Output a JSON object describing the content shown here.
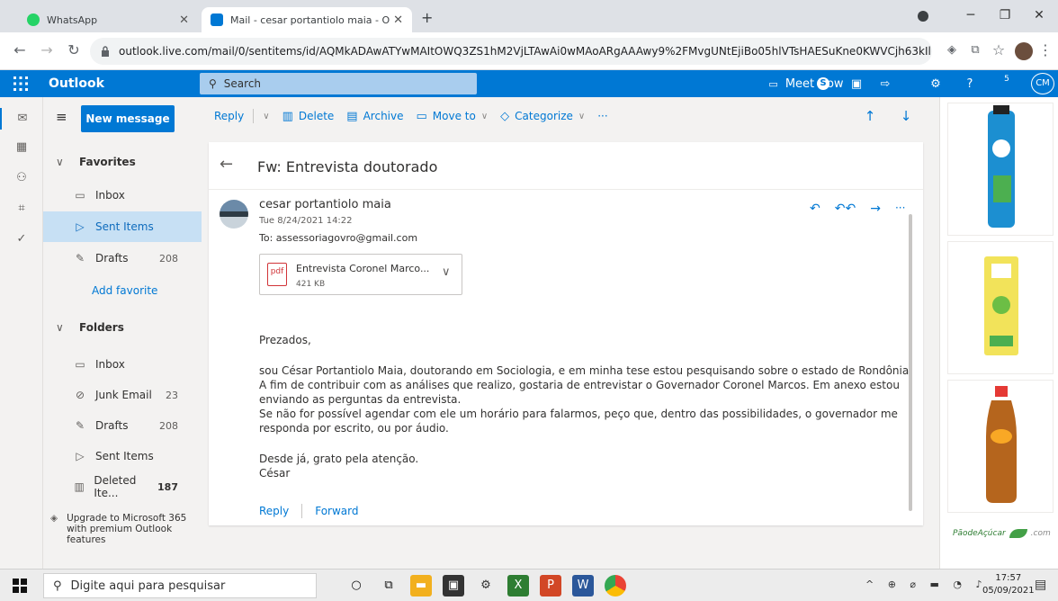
{
  "browser": {
    "tabs": [
      {
        "title": "WhatsApp",
        "active": false,
        "color": "#25d366"
      },
      {
        "title": "Mail - cesar portantiolo maia - O",
        "active": true,
        "color": "#0078d4"
      }
    ],
    "new_tab": "+",
    "url": "outlook.live.com/mail/0/sentitems/id/AQMkADAwATYwMAItOWQ3ZS1hM2VjLTAwAi0wMAoARgAAAwy9%2FMvgUNtEjiBo05hlVTsHAESuKne0KWVCjh63kIlNhooAAAIB..."
  },
  "outlook_header": {
    "brand": "Outlook",
    "search_placeholder": "Search",
    "meet_now": "Meet Now",
    "badge_count": "5",
    "user_initials": "CM"
  },
  "folder_pane": {
    "new_message": "New message",
    "favorites_label": "Favorites",
    "favorites": [
      {
        "label": "Inbox",
        "count": "",
        "icon": "inbox-icon",
        "glyph": "▭",
        "selected": false
      },
      {
        "label": "Sent Items",
        "count": "",
        "icon": "send-icon",
        "glyph": "▷",
        "selected": true
      },
      {
        "label": "Drafts",
        "count": "208",
        "icon": "pencil-icon",
        "glyph": "✎",
        "selected": false
      }
    ],
    "add_favorite": "Add favorite",
    "folders_label": "Folders",
    "folders": [
      {
        "label": "Inbox",
        "count": "",
        "icon": "inbox-icon",
        "glyph": "▭"
      },
      {
        "label": "Junk Email",
        "count": "23",
        "icon": "block-icon",
        "glyph": "⊘"
      },
      {
        "label": "Drafts",
        "count": "208",
        "icon": "pencil-icon",
        "glyph": "✎"
      },
      {
        "label": "Sent Items",
        "count": "",
        "icon": "send-icon",
        "glyph": "▷"
      },
      {
        "label": "Deleted Ite...",
        "count": "187",
        "icon": "trash-icon",
        "glyph": "🗑"
      }
    ],
    "upgrade_text": "Upgrade to Microsoft 365 with premium Outlook features"
  },
  "command_bar": {
    "reply": "Reply",
    "delete": "Delete",
    "archive": "Archive",
    "move_to": "Move to",
    "categorize": "Categorize",
    "more": "···"
  },
  "message": {
    "subject": "Fw: Entrevista doutorado",
    "sender": "cesar portantiolo maia",
    "date": "Tue 8/24/2021 14:22",
    "to": "To:  assessoriagovro@gmail.com",
    "attachment": {
      "name": "Entrevista Coronel Marco...",
      "size": "421 KB",
      "type": "pdf"
    },
    "body": [
      "Prezados,",
      "sou César Portantiolo Maia, doutorando em Sociologia, e em minha tese estou pesquisando sobre o estado de Rondônia. A fim de contribuir com as análises que realizo, gostaria de entrevistar o Governador Coronel Marcos. Em anexo estou enviando as perguntas da entrevista.\nSe não for possível agendar com ele um horário para falarmos, peço que, dentro das possibilidades, o governador me responda por escrito, ou por áudio.",
      "Desde já, grato pela atenção.\nCésar"
    ],
    "reply_link": "Reply",
    "forward_link": "Forward"
  },
  "ads": {
    "brand_text": "PãodeAçúcar",
    "brand_suffix": ".com"
  },
  "taskbar": {
    "search_placeholder": "Digite aqui para pesquisar",
    "time": "17:57",
    "date": "05/09/2021"
  },
  "colors": {
    "outlook_blue": "#0078d4",
    "selected_bg": "#c7e0f4",
    "pane_bg": "#f3f2f1"
  }
}
